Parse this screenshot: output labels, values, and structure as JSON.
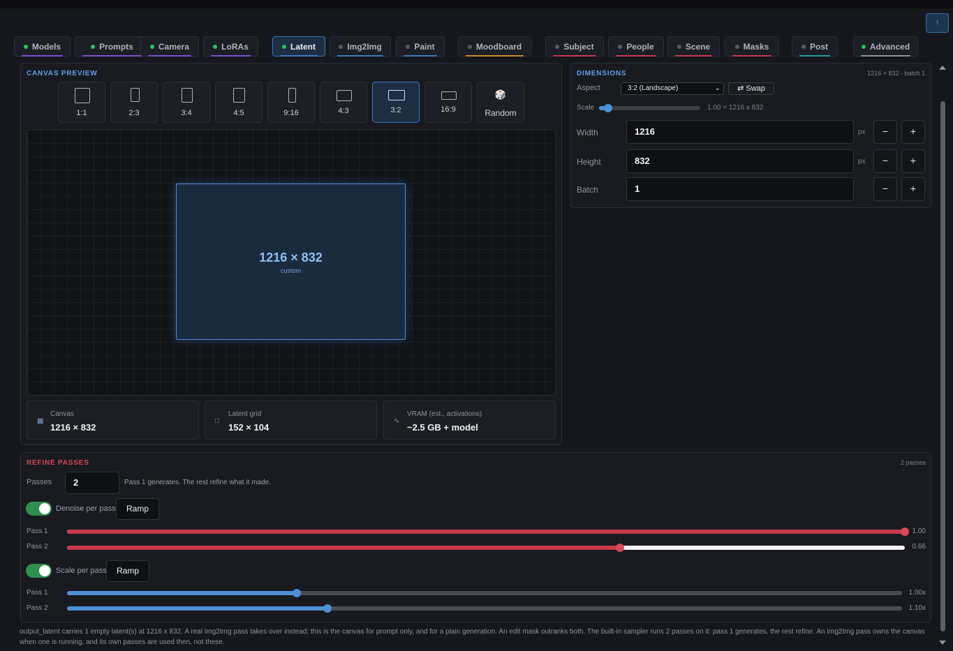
{
  "top_button": "↑",
  "tabs": [
    {
      "label": "Models",
      "on": true,
      "underline": "#7a4fd0"
    },
    {
      "label": "Prompts",
      "on": true,
      "underline": "#7a4fd0"
    },
    {
      "label": "Camera",
      "on": true,
      "underline": "#7a4fd0"
    },
    {
      "label": "LoRAs",
      "on": true,
      "underline": "#7a4fd0"
    },
    {
      "label": "Latent",
      "on": true,
      "underline": "#3d78bf"
    },
    {
      "label": "Img2Img",
      "on": false,
      "underline": "#3d78bf"
    },
    {
      "label": "Paint",
      "on": false,
      "underline": "#3d78bf"
    },
    {
      "label": "Moodboard",
      "on": false,
      "underline": "#c98a2a"
    },
    {
      "label": "Subject",
      "on": false,
      "underline": "#c0394f"
    },
    {
      "label": "People",
      "on": false,
      "underline": "#c0394f"
    },
    {
      "label": "Scene",
      "on": false,
      "underline": "#c0394f"
    },
    {
      "label": "Masks",
      "on": false,
      "underline": "#c0394f"
    },
    {
      "label": "Post",
      "on": false,
      "underline": "#2a9a9a"
    },
    {
      "label": "Advanced",
      "on": true,
      "underline": "#8a9099"
    }
  ],
  "canvas_preview": {
    "title": "CANVAS PREVIEW",
    "aspects": [
      "1:1",
      "2:3",
      "3:4",
      "4:5",
      "9:16",
      "4:3",
      "3:2",
      "16:9",
      "Random"
    ],
    "active_aspect": "3:2",
    "dims_text": "1216 × 832",
    "custom_label": "custom",
    "stats": [
      {
        "icon": "▦",
        "label": "Canvas",
        "value": "1216 × 832"
      },
      {
        "icon": "□",
        "label": "Latent grid",
        "value": "152 × 104"
      },
      {
        "icon": "∿",
        "label": "VRAM (est., activations)",
        "value": "~2.5 GB + model"
      }
    ]
  },
  "dimensions": {
    "title": "DIMENSIONS",
    "summary": "1216 × 832 · batch 1",
    "aspect_label": "Aspect",
    "aspect_value": "3:2 (Landscape)",
    "swap_label": "⇄ Swap",
    "scale_label": "Scale",
    "scale_value": 1.0,
    "scale_text": "1.00 = 1216 x 832",
    "width_label": "Width",
    "width_value": "1216",
    "height_label": "Height",
    "height_value": "832",
    "batch_label": "Batch",
    "batch_value": "1",
    "unit": "px",
    "minus": "−",
    "plus": "+"
  },
  "refine": {
    "title": "REFINE PASSES",
    "count_text": "2 passes",
    "passes_label": "Passes",
    "passes_value": "2",
    "passes_hint": "Pass 1 generates. The rest refine what it made.",
    "denoise_label": "Denoise per pass",
    "scale_label": "Scale per pass",
    "ramp_label": "Ramp",
    "denoise": [
      {
        "label": "Pass 1",
        "value": 1.0,
        "text": "1.00"
      },
      {
        "label": "Pass 2",
        "value": 0.66,
        "text": "0.66"
      }
    ],
    "scale": [
      {
        "label": "Pass 1",
        "fraction": 0.275,
        "text": "1.00x"
      },
      {
        "label": "Pass 2",
        "fraction": 0.312,
        "text": "1.10x"
      }
    ]
  },
  "footer_note": "output_latent carries 1 empty latent(s) at 1216 x 832. A real Img2Img pass takes over instead; this is the canvas for prompt only, and for a plain generation. An edit mask outranks both. The built-in sampler runs 2 passes on it: pass 1 generates, the rest refine. An Img2Img pass owns the canvas when one is running, and its own passes are used then, not these.",
  "colors": {
    "accent_blue": "#4f8fd8",
    "refine_red": "#c8384a",
    "toggle_green": "#2f8f4f"
  }
}
